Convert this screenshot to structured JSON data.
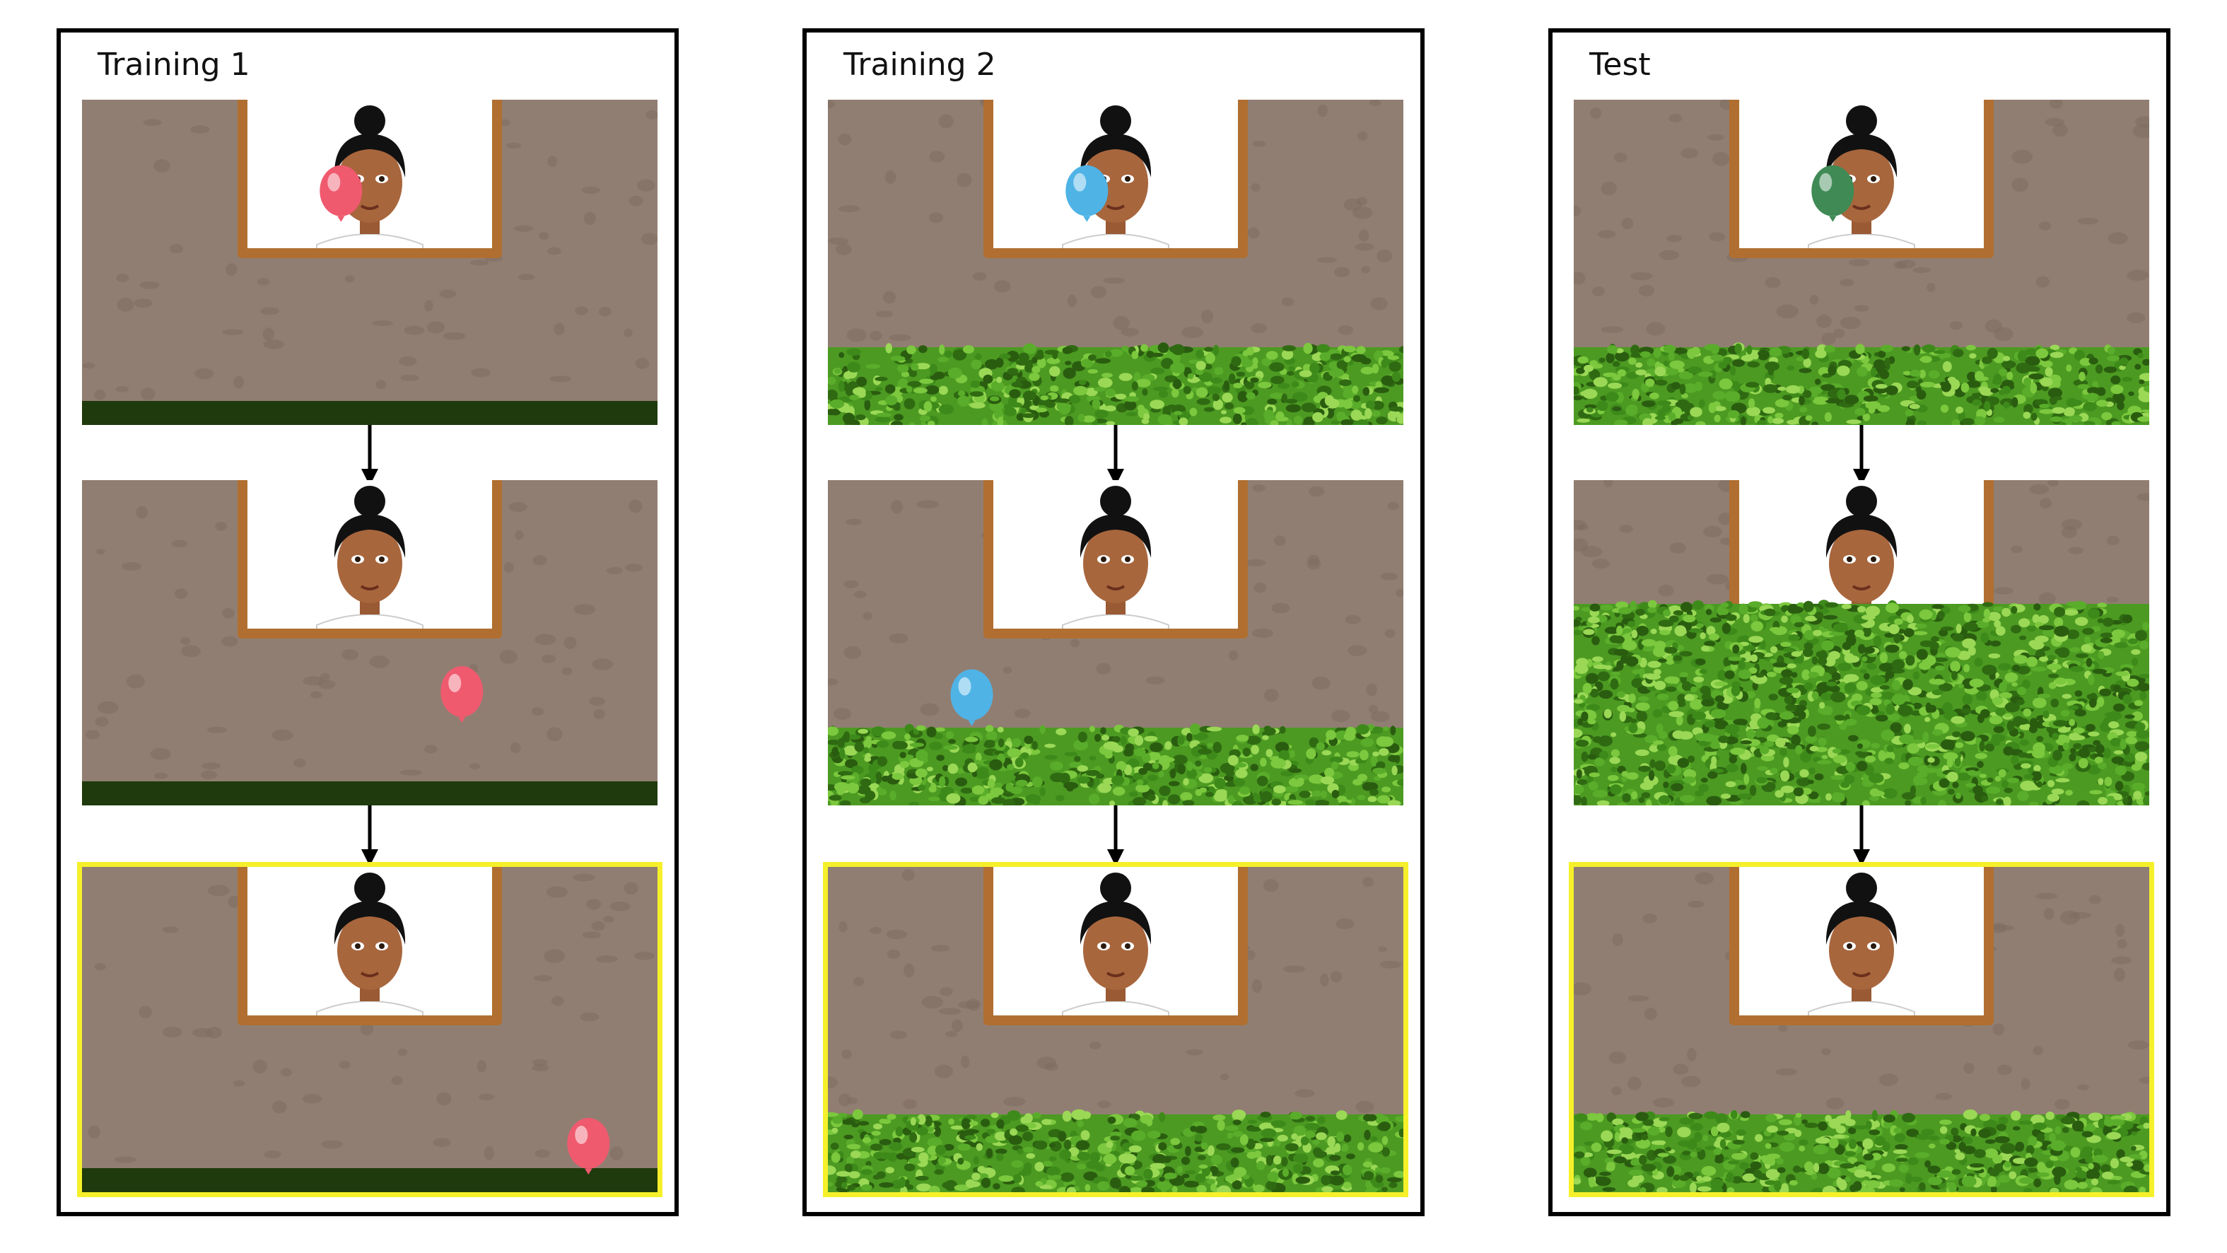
{
  "panels": [
    {
      "title": "Training 1",
      "balloon_color": "#ef5a6e"
    },
    {
      "title": "Training 2",
      "balloon_color": "#4fb3e6"
    },
    {
      "title": "Test",
      "balloon_color": "#3f8a55"
    }
  ],
  "colors": {
    "wall": "#917e72",
    "window_frame": "#b06f30",
    "grass_dark": "#1f3a0c",
    "hedge": "#4c9a22",
    "highlight": "#f6f02a"
  },
  "icons": [
    "person-face-icon",
    "balloon-icon",
    "hedge-icon",
    "down-arrow-icon"
  ]
}
